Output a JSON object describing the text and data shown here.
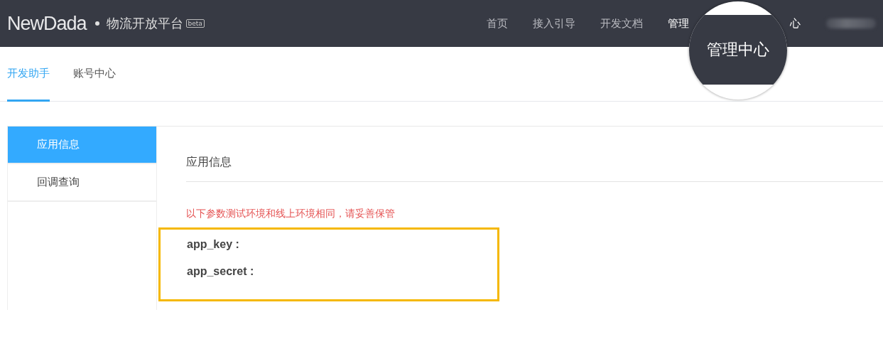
{
  "header": {
    "logo": {
      "light": "New",
      "bold": "Dada"
    },
    "platform": "物流开放平台",
    "badge": "beta",
    "nav": [
      {
        "label": "首页",
        "selected": false
      },
      {
        "label": "接入引导",
        "selected": false
      },
      {
        "label": "开发文档",
        "selected": false
      },
      {
        "label": "管理",
        "selected": true
      },
      {
        "label": "心",
        "selected": true
      }
    ]
  },
  "magnifier": {
    "label": "管理中心"
  },
  "tabs": [
    {
      "label": "开发助手",
      "selected": true
    },
    {
      "label": "账号中心",
      "selected": false
    }
  ],
  "sidebar": {
    "items": [
      {
        "label": "应用信息",
        "selected": true
      },
      {
        "label": "回调查询",
        "selected": false
      }
    ]
  },
  "content": {
    "title": "应用信息",
    "notice": "以下参数测试环境和线上环境相同，请妥善保管",
    "fields": [
      {
        "label": "app_key :"
      },
      {
        "label": "app_secret :"
      }
    ]
  }
}
